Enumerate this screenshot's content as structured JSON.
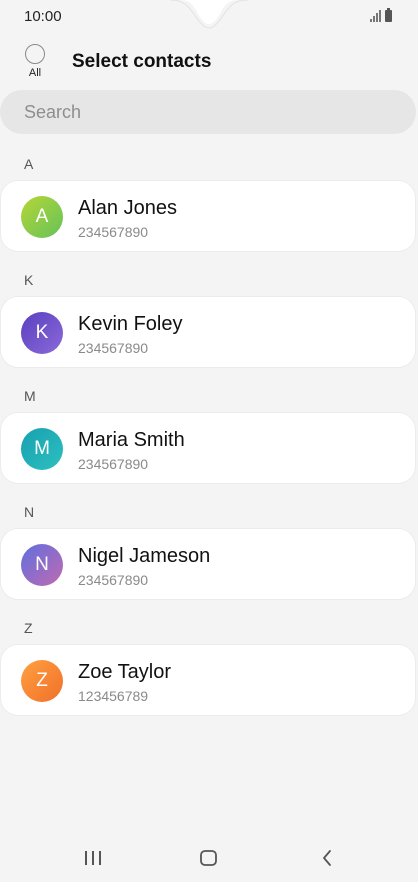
{
  "status_bar": {
    "time": "10:00"
  },
  "header": {
    "select_all_label": "All",
    "title": "Select contacts"
  },
  "search": {
    "placeholder": "Search"
  },
  "sections": [
    {
      "letter": "A",
      "contacts": [
        {
          "initial": "A",
          "name": "Alan Jones",
          "number": "234567890",
          "avatar_color": "#8ccb3c"
        }
      ]
    },
    {
      "letter": "K",
      "contacts": [
        {
          "initial": "K",
          "name": "Kevin Foley",
          "number": "234567890",
          "avatar_color": "#6a4fc4"
        }
      ]
    },
    {
      "letter": "M",
      "contacts": [
        {
          "initial": "M",
          "name": "Maria Smith",
          "number": "234567890",
          "avatar_color": "#1faab5"
        }
      ]
    },
    {
      "letter": "N",
      "contacts": [
        {
          "initial": "N",
          "name": "Nigel Jameson",
          "number": "234567890",
          "avatar_color": "#8a6fd0"
        }
      ]
    },
    {
      "letter": "Z",
      "contacts": [
        {
          "initial": "Z",
          "name": "Zoe Taylor",
          "number": "123456789",
          "avatar_color": "#f58a2e"
        }
      ]
    }
  ],
  "nav_bar": {
    "icons": [
      "recent-apps-icon",
      "home-icon",
      "back-icon"
    ]
  }
}
